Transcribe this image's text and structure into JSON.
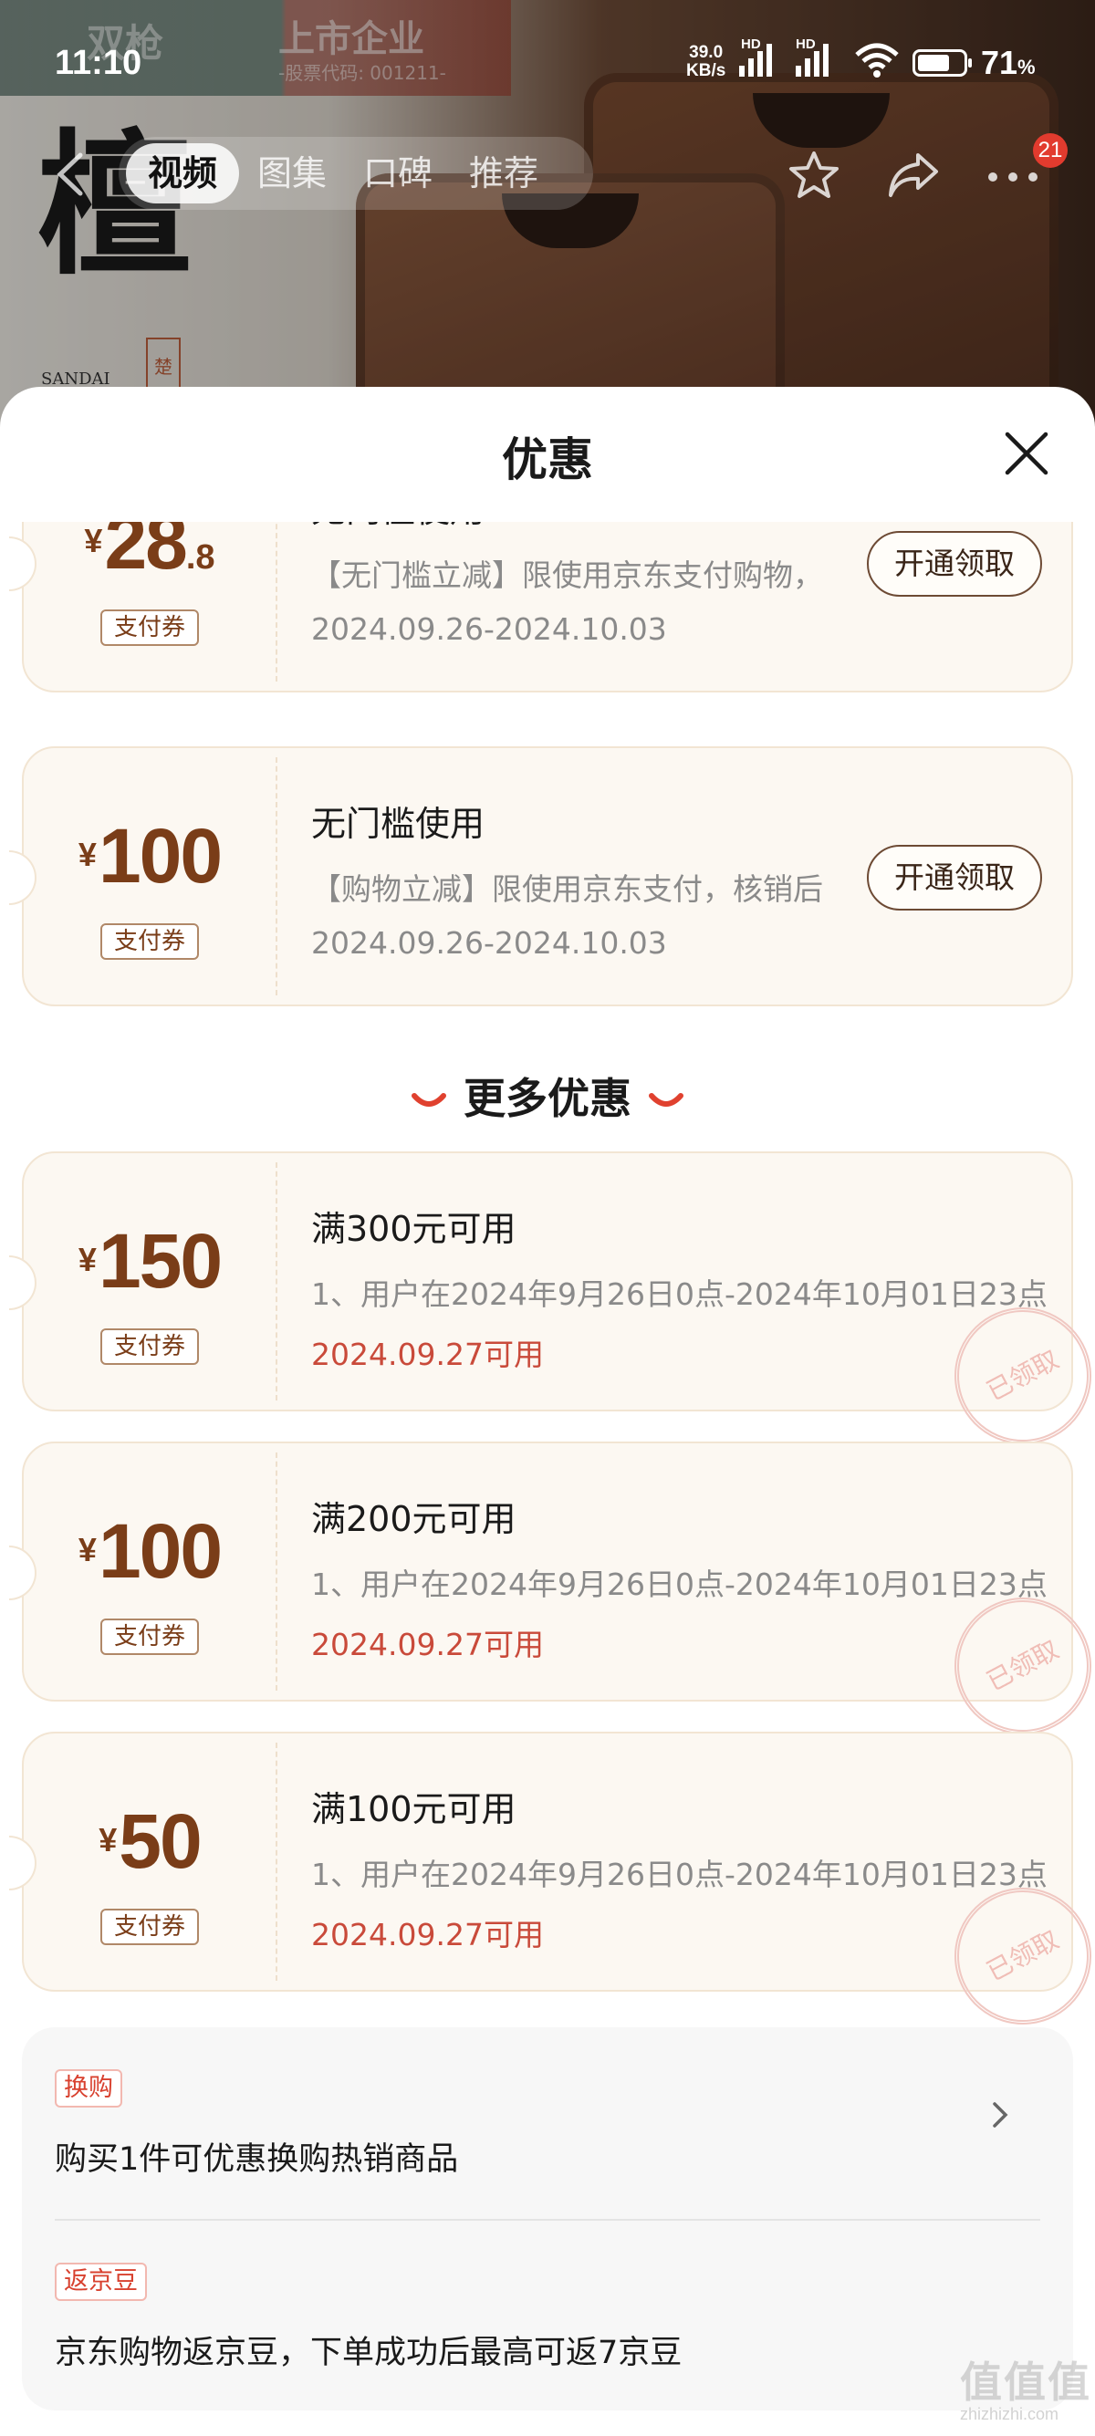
{
  "status_bar": {
    "time": "11:10",
    "net_speed_value": "39.0",
    "net_speed_unit": "KB/s",
    "hd1": "HD",
    "hd2": "HD",
    "battery": "71",
    "battery_unit": "%",
    "battery_level": 0.71
  },
  "banner": {
    "brand": "双枪",
    "listed": "上市企业",
    "stock_code": "-股票代码: 001211-",
    "calligraphy": "檀",
    "seal": "楚",
    "sandai": "SANDAI"
  },
  "nav": {
    "tabs": [
      "视频",
      "图集",
      "口碑",
      "推荐"
    ],
    "active_tab": 0,
    "badge": "21"
  },
  "sheet": {
    "title": "优惠"
  },
  "coupons": [
    {
      "yen": "¥",
      "amount": "28",
      "decimal": ".8",
      "tag": "支付券",
      "condition": "无门槛使用",
      "desc": "【无门槛立减】限使用京东支付购物，",
      "date": "2024.09.26-2024.10.03",
      "button": "开通领取"
    },
    {
      "yen": "¥",
      "amount": "100",
      "decimal": "",
      "tag": "支付券",
      "condition": "无门槛使用",
      "desc": "【购物立减】限使用京东支付，核销后",
      "date": "2024.09.26-2024.10.03",
      "button": "开通领取"
    }
  ],
  "more_section": {
    "title": "更多优惠"
  },
  "more_coupons": [
    {
      "yen": "¥",
      "amount": "150",
      "tag": "支付券",
      "condition": "满300元可用",
      "desc": "1、用户在2024年9月26日0点-2024年10月01日23点",
      "date": "2024.09.27可用",
      "stamp": "已领取"
    },
    {
      "yen": "¥",
      "amount": "100",
      "tag": "支付券",
      "condition": "满200元可用",
      "desc": "1、用户在2024年9月26日0点-2024年10月01日23点",
      "date": "2024.09.27可用",
      "stamp": "已领取"
    },
    {
      "yen": "¥",
      "amount": "50",
      "tag": "支付券",
      "condition": "满100元可用",
      "desc": "1、用户在2024年9月26日0点-2024年10月01日23点",
      "date": "2024.09.27可用",
      "stamp": "已领取"
    }
  ],
  "info": {
    "exchange_label": "换购",
    "exchange_text": "购买1件可优惠换购热销商品",
    "bean_label": "返京豆",
    "bean_text": "京东购物返京豆，下单成功后最高可返7京豆"
  },
  "watermark": {
    "text": "值值值",
    "sub": "zhizhizhi.com"
  },
  "colors": {
    "amount_brown": "#7a3d18",
    "date_red": "#c94a3a",
    "label_red": "#d8412f",
    "badge_red": "#e23b2e",
    "card_bg": "#fcf8f2"
  }
}
